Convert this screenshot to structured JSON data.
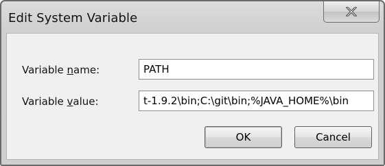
{
  "window": {
    "title": "Edit System Variable"
  },
  "titlebar": {
    "close_icon": "close-x-icon"
  },
  "form": {
    "name_label_pre": "Variable ",
    "name_label_key": "n",
    "name_label_post": "ame:",
    "name_value": "PATH",
    "value_label_pre": "Variable ",
    "value_label_key": "v",
    "value_label_post": "alue:",
    "value_value": "t-1.9.2\\bin;C:\\git\\bin;%JAVA_HOME%\\bin"
  },
  "buttons": {
    "ok_label": "OK",
    "cancel_label": "Cancel"
  }
}
